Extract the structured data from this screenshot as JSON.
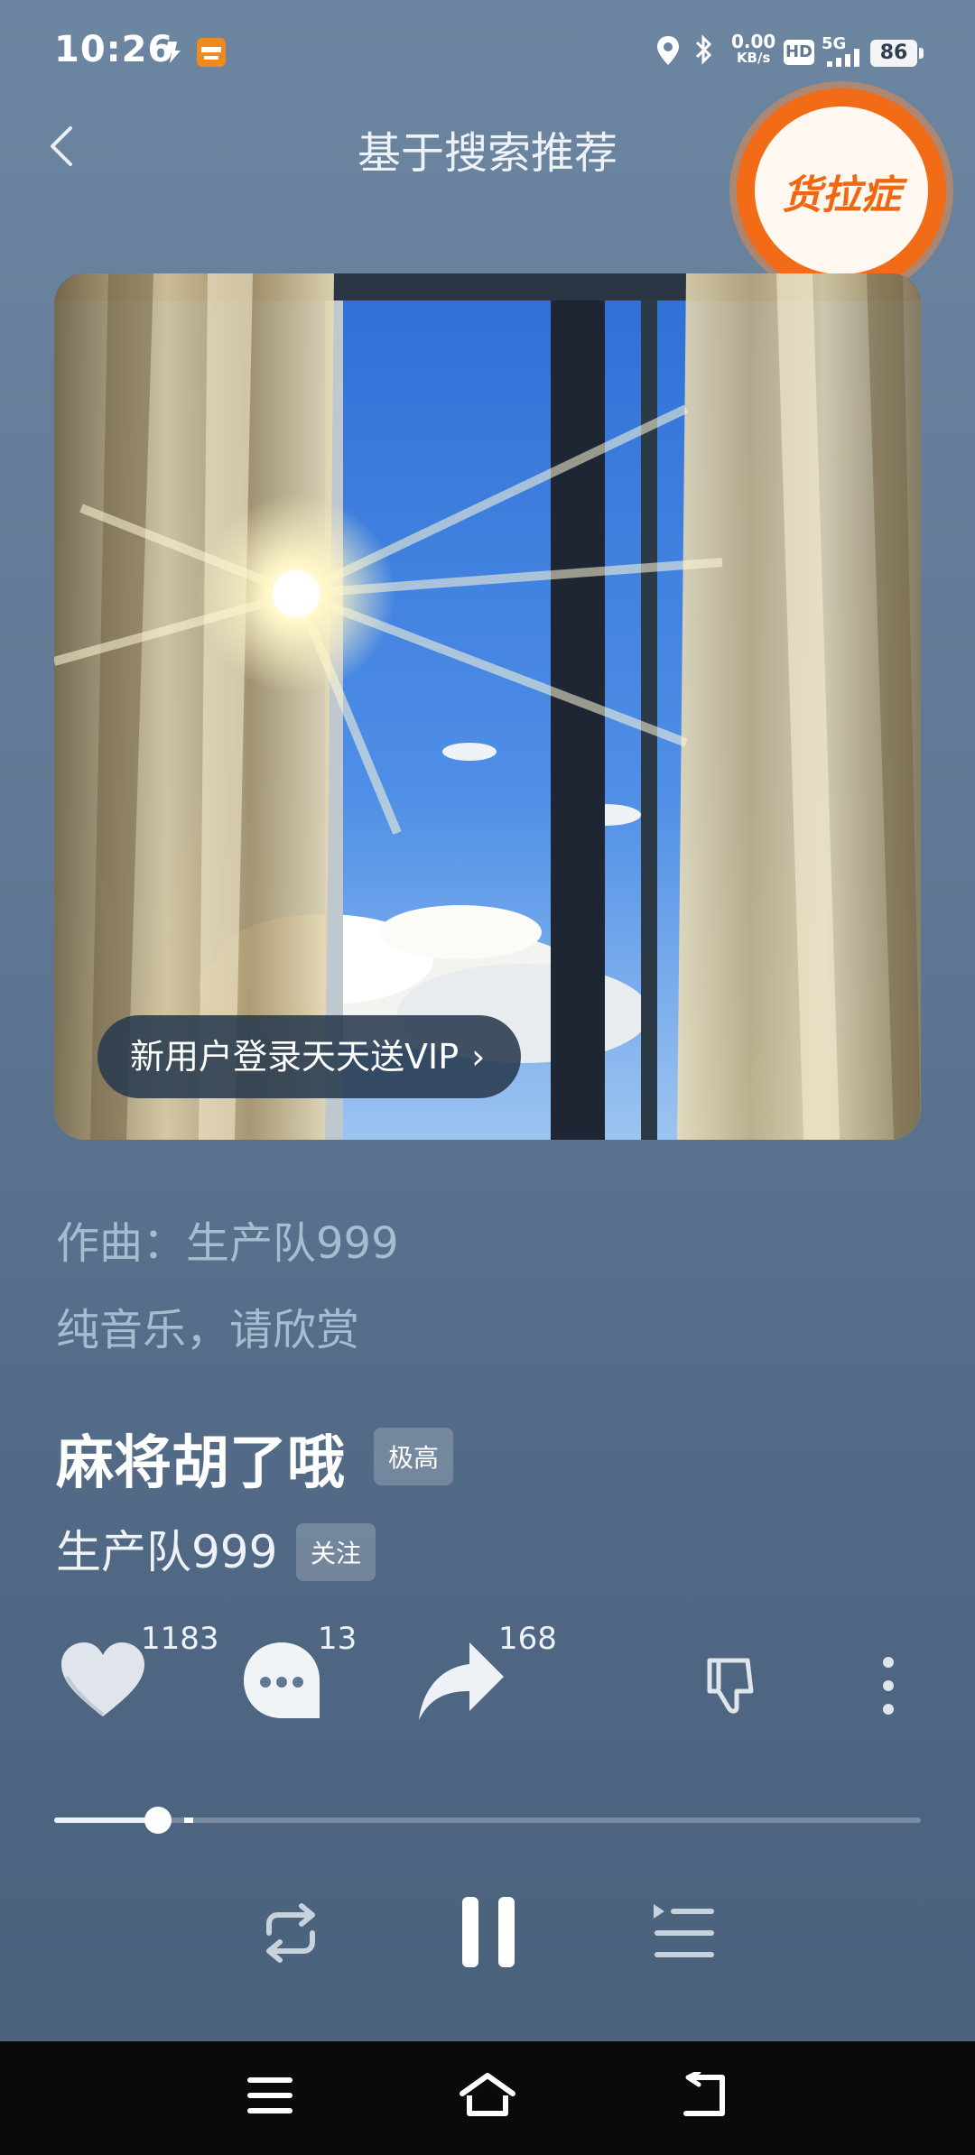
{
  "status_bar": {
    "time": "10:26",
    "net_speed_value": "0.00",
    "net_speed_unit": "KB/s",
    "hd_label": "HD",
    "network_label": "5G",
    "battery": "86"
  },
  "header": {
    "title": "基于搜索推荐",
    "floating_badge_text": "货拉症"
  },
  "cover": {
    "vip_banner": "新用户登录天天送VIP",
    "vip_chevron": "›"
  },
  "lyrics": [
    "作曲：生产队999",
    "纯音乐，请欣赏"
  ],
  "song": {
    "title": "麻将胡了哦",
    "quality_tag": "极高",
    "artist": "生产队999",
    "follow_label": "关注"
  },
  "actions": {
    "like_count": "1183",
    "comment_count": "13",
    "share_count": "168"
  },
  "progress": {
    "played_fraction": 0.12
  },
  "icons": [
    "back-icon",
    "heart-icon",
    "comment-icon",
    "share-icon",
    "dislike-icon",
    "more-icon",
    "repeat-icon",
    "pause-icon",
    "playlist-icon",
    "menu-icon",
    "home-icon",
    "return-icon"
  ]
}
